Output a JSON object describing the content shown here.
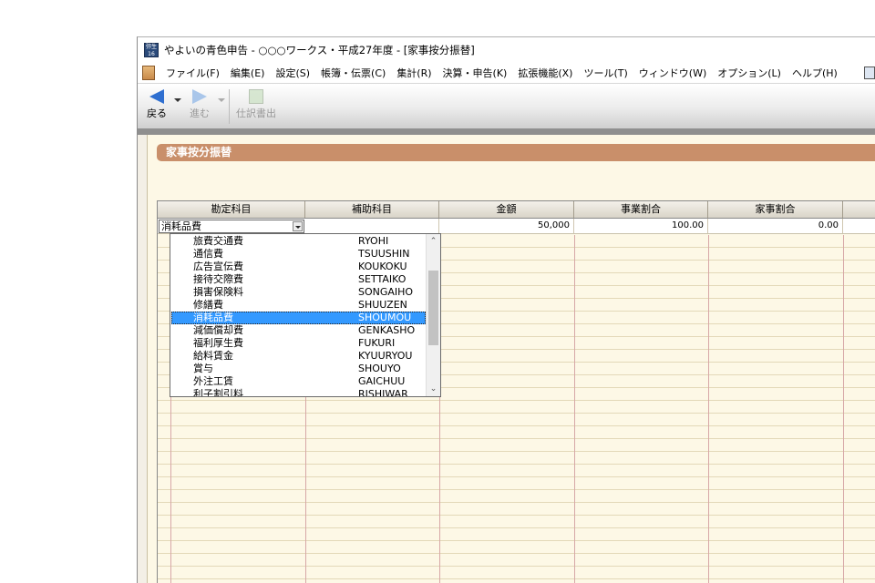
{
  "window": {
    "title": "やよいの青色申告 - ○○○ワークス・平成27年度 - [家事按分振替]",
    "app_icon_text": "弥生 16"
  },
  "menu": {
    "items": [
      "ファイル(F)",
      "編集(E)",
      "設定(S)",
      "帳簿・伝票(C)",
      "集計(R)",
      "決算・申告(K)",
      "拡張機能(X)",
      "ツール(T)",
      "ウィンドウ(W)",
      "オプション(L)",
      "ヘルプ(H)"
    ]
  },
  "toolbar": {
    "back_label": "戻る",
    "forward_label": "進む",
    "journal_label": "仕訳書出"
  },
  "section": {
    "title": "家事按分振替"
  },
  "grid": {
    "columns": [
      "勘定科目",
      "補助科目",
      "金額",
      "事業割合",
      "家事割合"
    ],
    "row": {
      "account": "消耗品費",
      "sub_account": "",
      "amount": "50,000",
      "business_ratio": "100.00",
      "household_ratio": "0.00"
    }
  },
  "dropdown": {
    "items": [
      {
        "name": "旅費交通費",
        "code": "RYOHI"
      },
      {
        "name": "通信費",
        "code": "TSUUSHIN"
      },
      {
        "name": "広告宣伝費",
        "code": "KOUKOKU"
      },
      {
        "name": "接待交際費",
        "code": "SETTAIKO"
      },
      {
        "name": "損害保険料",
        "code": "SONGAIHO"
      },
      {
        "name": "修繕費",
        "code": "SHUUZEN"
      },
      {
        "name": "消耗品費",
        "code": "SHOUMOU"
      },
      {
        "name": "減価償却費",
        "code": "GENKASHO"
      },
      {
        "name": "福利厚生費",
        "code": "FUKURI"
      },
      {
        "name": "給料賃金",
        "code": "KYUURYOU"
      },
      {
        "name": "賞与",
        "code": "SHOUYO"
      },
      {
        "name": "外注工賃",
        "code": "GAICHUU"
      },
      {
        "name": "利子割引料",
        "code": "RISHIWAR"
      }
    ],
    "selected_index": 6,
    "scroll_up_glyph": "⌃",
    "scroll_down_glyph": "⌄"
  },
  "colors": {
    "section_header": "#c98f6a",
    "selection": "#3399ff",
    "content_bg": "#fdf8e6"
  }
}
